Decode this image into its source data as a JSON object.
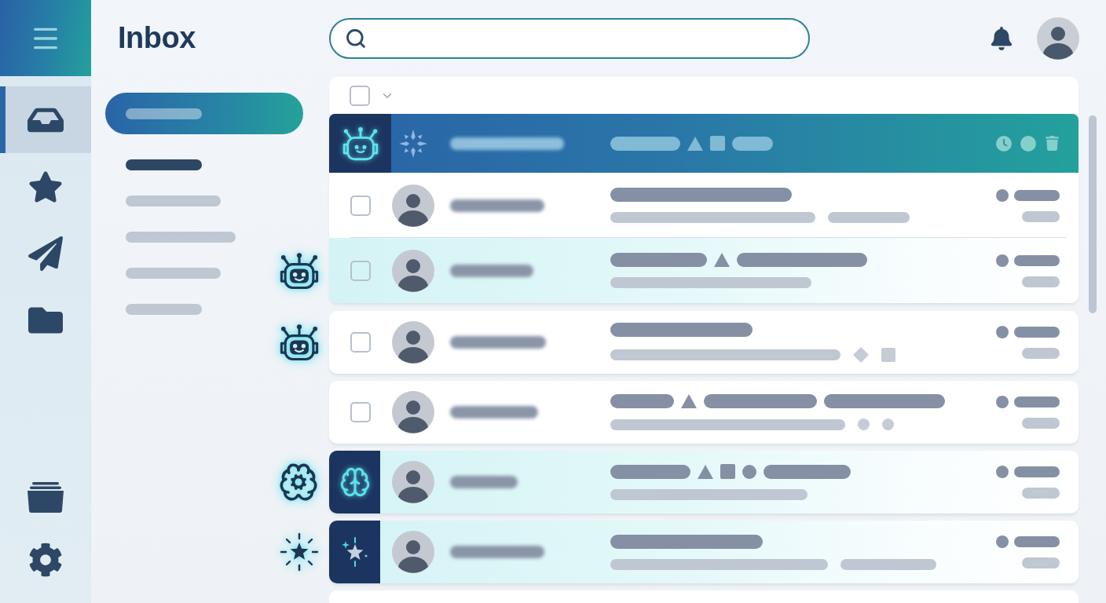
{
  "nav_rail": {
    "items": [
      {
        "selected": true
      },
      {
        "selected": false
      },
      {
        "selected": false
      },
      {
        "selected": false
      }
    ]
  },
  "header": {
    "title": "Inbox"
  },
  "folders": [
    {
      "selected": true,
      "unread": false
    },
    {
      "selected": false,
      "unread": true
    },
    {
      "selected": false,
      "unread": false
    },
    {
      "selected": false,
      "unread": false
    },
    {
      "selected": false,
      "unread": false
    },
    {
      "selected": false,
      "unread": false
    }
  ],
  "toolbar": {
    "select_all": {
      "checked": false
    }
  },
  "rows": [
    {
      "kind": "summary",
      "selected": true,
      "highlighted": false,
      "badge": {
        "kind": "bot"
      },
      "subject": [
        {
          "kind": "bar"
        },
        {
          "kind": "triangle"
        },
        {
          "kind": "square"
        },
        {
          "kind": "bar"
        }
      ]
    },
    {
      "kind": "message",
      "selected": false,
      "highlighted": false,
      "checked": false,
      "subject": [
        {
          "kind": "bar"
        }
      ],
      "preview": [
        {
          "kind": "bar"
        },
        {
          "kind": "bar"
        }
      ]
    },
    {
      "kind": "message",
      "selected": false,
      "highlighted": true,
      "checked": false,
      "annotation": {
        "kind": "bot"
      },
      "subject": [
        {
          "kind": "bar"
        },
        {
          "kind": "triangle"
        },
        {
          "kind": "bar"
        }
      ],
      "preview": [
        {
          "kind": "bar"
        }
      ]
    },
    {
      "kind": "message",
      "selected": false,
      "highlighted": false,
      "checked": false,
      "annotation": {
        "kind": "bot"
      },
      "subject": [
        {
          "kind": "bar"
        }
      ],
      "preview": [
        {
          "kind": "bar"
        },
        {
          "kind": "diamond"
        },
        {
          "kind": "square"
        }
      ]
    },
    {
      "kind": "message",
      "selected": false,
      "highlighted": false,
      "checked": false,
      "subject": [
        {
          "kind": "bar"
        },
        {
          "kind": "triangle"
        },
        {
          "kind": "bar"
        },
        {
          "kind": "bar"
        }
      ],
      "preview": [
        {
          "kind": "bar"
        },
        {
          "kind": "dot"
        },
        {
          "kind": "dot"
        }
      ]
    },
    {
      "kind": "message",
      "selected": false,
      "highlighted": true,
      "badge": {
        "kind": "brain"
      },
      "annotation": {
        "kind": "brain"
      },
      "subject": [
        {
          "kind": "bar"
        },
        {
          "kind": "triangle"
        },
        {
          "kind": "square"
        },
        {
          "kind": "dot"
        },
        {
          "kind": "bar"
        }
      ],
      "preview": [
        {
          "kind": "bar"
        }
      ]
    },
    {
      "kind": "message",
      "selected": false,
      "highlighted": true,
      "badge": {
        "kind": "star"
      },
      "annotation": {
        "kind": "star"
      },
      "subject": [
        {
          "kind": "bar"
        }
      ],
      "preview": [
        {
          "kind": "bar"
        },
        {
          "kind": "bar"
        }
      ]
    }
  ]
}
